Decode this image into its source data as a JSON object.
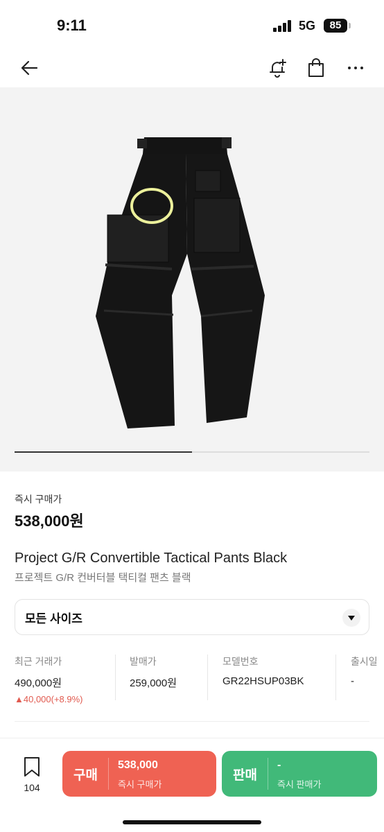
{
  "status": {
    "time": "9:11",
    "network": "5G",
    "battery": "85"
  },
  "price": {
    "label": "즉시 구매가",
    "value": "538,000원"
  },
  "product": {
    "name_en": "Project G/R Convertible Tactical Pants Black",
    "name_ko": "프로젝트 G/R 컨버터블 택티컬 팬츠 블랙"
  },
  "size_select": {
    "value": "모든 사이즈"
  },
  "info": [
    {
      "label": "최근 거래가",
      "value": "490,000원",
      "change": "▲40,000(+8.9%)"
    },
    {
      "label": "발매가",
      "value": "259,000원"
    },
    {
      "label": "모델번호",
      "value": "GR22HSUP03BK"
    },
    {
      "label": "출시일",
      "value": "-"
    }
  ],
  "image_indicator": {
    "progress": 0.5
  },
  "bottom_bar": {
    "bookmark_count": "104",
    "buy": {
      "label": "구매",
      "price": "538,000",
      "sub": "즉시 구매가"
    },
    "sell": {
      "label": "판매",
      "price": "-",
      "sub": "즉시 판매가"
    }
  },
  "colors": {
    "buy": "#ef6253",
    "sell": "#41b979",
    "price_up": "#e15a4f"
  }
}
